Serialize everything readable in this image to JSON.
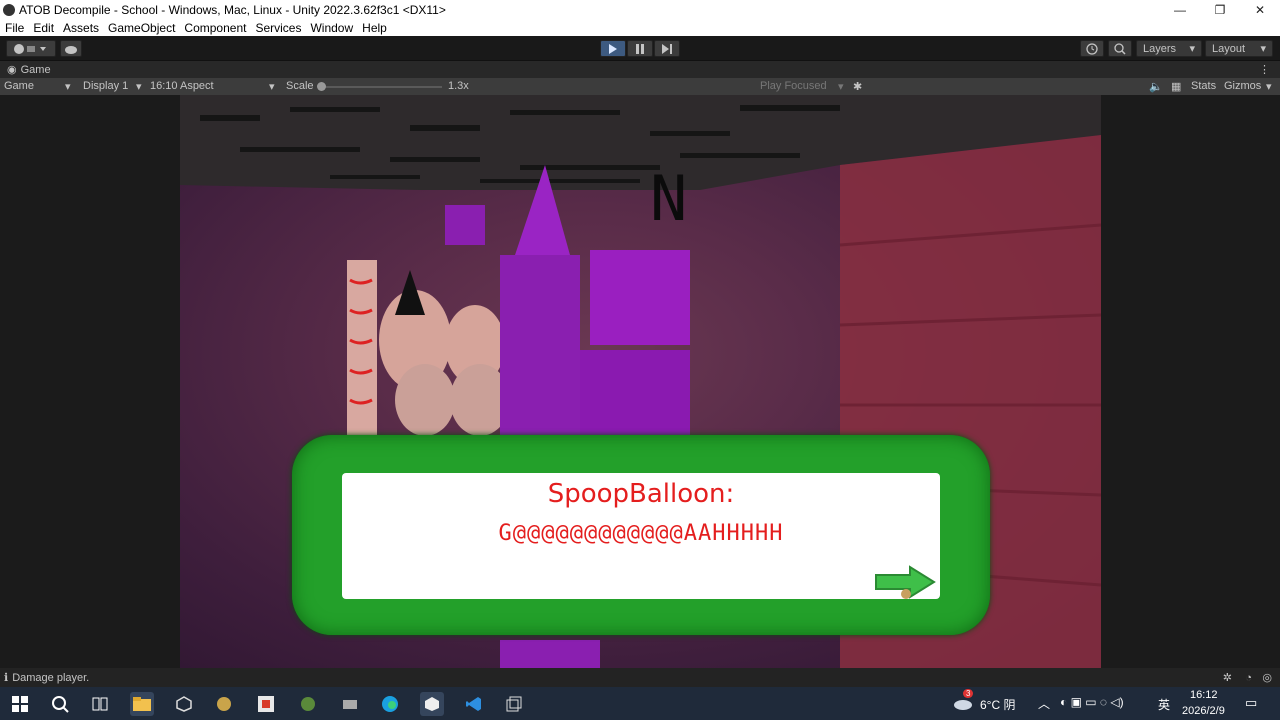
{
  "window": {
    "title": "ATOB Decompile - School - Windows, Mac, Linux - Unity 2022.3.62f3c1 <DX11>",
    "minimize": "—",
    "maximize": "❐",
    "close": "✕"
  },
  "menu": [
    "File",
    "Edit",
    "Assets",
    "GameObject",
    "Component",
    "Services",
    "Window",
    "Help"
  ],
  "toolbar": {
    "layers_label": "Layers",
    "layout_label": "Layout"
  },
  "tab": {
    "label": "Game"
  },
  "game_toolbar": {
    "view_mode": "Game",
    "display": "Display 1",
    "aspect": "16:10 Aspect",
    "scale_label": "Scale",
    "scale_value": "1.3x",
    "play_focused": "Play Focused",
    "stats": "Stats",
    "gizmos": "Gizmos"
  },
  "dialog": {
    "speaker": "SpoopBalloon:",
    "text": "G@@@@@@@@@@@@AAHHHHH"
  },
  "scene": {
    "sign_text": "N"
  },
  "status": {
    "message": "Damage player."
  },
  "taskbar": {
    "weather_badge": "3",
    "weather": "6°C 阴",
    "ime": "英",
    "time": "16:12",
    "date": "2026/2/9"
  },
  "colors": {
    "accent_play": "#3d5a80",
    "dialog_green": "#23a02a",
    "dialog_text": "#e41e1e"
  }
}
